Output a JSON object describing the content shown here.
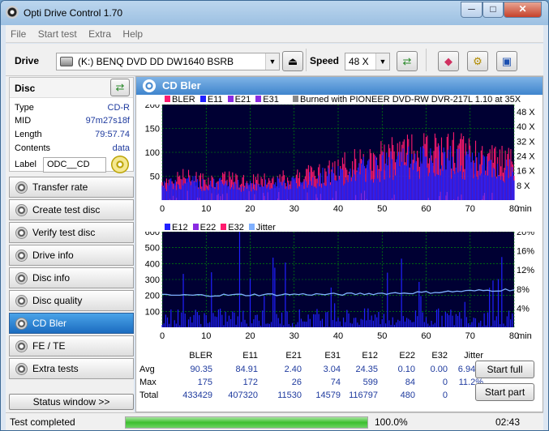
{
  "window": {
    "title": "Opti Drive Control 1.70",
    "min": "─",
    "max": "□",
    "close": "✕"
  },
  "menu": [
    "File",
    "Start test",
    "Extra",
    "Help"
  ],
  "toolbar": {
    "drive_label": "Drive",
    "drive_value": "(K:)  BENQ DVD DD DW1640 BSRB",
    "speed_label": "Speed",
    "speed_value": "48 X"
  },
  "disc": {
    "header": "Disc",
    "rows": [
      {
        "k": "Type",
        "v": "CD-R"
      },
      {
        "k": "MID",
        "v": "97m27s18f"
      },
      {
        "k": "Length",
        "v": "79:57.74"
      },
      {
        "k": "Contents",
        "v": "data"
      }
    ],
    "label_key": "Label",
    "label_value": "ODC__CD"
  },
  "nav": [
    "Transfer rate",
    "Create test disc",
    "Verify test disc",
    "Drive info",
    "Disc info",
    "Disc quality",
    "CD Bler",
    "FE / TE",
    "Extra tests"
  ],
  "nav_active": "CD Bler",
  "status_window_btn": "Status window >>",
  "main": {
    "title": "CD Bler",
    "legend1": [
      "BLER",
      "E11",
      "E21",
      "E31"
    ],
    "burned": "Burned with PIONEER DVD-RW  DVR-217L 1.10 at 35X",
    "legend2": [
      "E12",
      "E22",
      "E32",
      "Jitter"
    ],
    "colors": {
      "bler": "#ff1a6e",
      "e11": "#2020ff",
      "e21": "#8a2be2",
      "e31": "#8a2be2",
      "e12": "#2020ff",
      "e22": "#8a2be2",
      "e32": "#ff1a6e",
      "jitter": "#7fb0ff",
      "burned": "#888888",
      "bg": "#000033",
      "grid": "#00a000"
    }
  },
  "chart_data": [
    {
      "type": "bar",
      "title": "",
      "xlabel": "min",
      "x_ticks": [
        "0",
        "10",
        "20",
        "30",
        "40",
        "50",
        "60",
        "70",
        "80"
      ],
      "y_ticks": [
        "50",
        "100",
        "150",
        "200"
      ],
      "ylim": [
        0,
        200
      ],
      "xlim": [
        0,
        80
      ],
      "y2_ticks": [
        "8 X",
        "16 X",
        "24 X",
        "32 X",
        "40 X",
        "48 X"
      ],
      "y2_values": [
        8,
        16,
        24,
        32,
        40,
        48
      ],
      "series": [
        {
          "name": "BLER",
          "x": [
            0,
            5,
            10,
            15,
            20,
            25,
            30,
            35,
            40,
            45,
            50,
            55,
            60,
            65,
            70,
            75,
            80
          ],
          "values": [
            40,
            50,
            45,
            45,
            40,
            45,
            50,
            60,
            70,
            85,
            95,
            105,
            105,
            110,
            100,
            90,
            80
          ]
        },
        {
          "name": "E11",
          "x": [
            0,
            5,
            10,
            15,
            20,
            25,
            30,
            35,
            40,
            45,
            50,
            55,
            60,
            65,
            70,
            75,
            80
          ],
          "values": [
            35,
            45,
            40,
            40,
            35,
            40,
            45,
            55,
            60,
            75,
            85,
            95,
            95,
            100,
            90,
            80,
            70
          ]
        }
      ]
    },
    {
      "type": "bar",
      "title": "",
      "xlabel": "min",
      "x_ticks": [
        "0",
        "10",
        "20",
        "30",
        "40",
        "50",
        "60",
        "70",
        "80"
      ],
      "y_ticks": [
        "100",
        "200",
        "300",
        "400",
        "500",
        "600"
      ],
      "ylim": [
        0,
        600
      ],
      "xlim": [
        0,
        80
      ],
      "y2_ticks": [
        "4%",
        "8%",
        "12%",
        "16%",
        "20%"
      ],
      "y2_values": [
        4,
        8,
        12,
        16,
        20
      ],
      "series": [
        {
          "name": "Jitter",
          "x": [
            0,
            10,
            20,
            30,
            40,
            50,
            60,
            70,
            80
          ],
          "values": [
            6.7,
            6.7,
            6.8,
            6.9,
            6.9,
            7.1,
            7.3,
            7.6,
            7.9
          ]
        }
      ]
    }
  ],
  "stats": {
    "headers": [
      "BLER",
      "E11",
      "E21",
      "E31",
      "E12",
      "E22",
      "E32",
      "Jitter"
    ],
    "rows": [
      {
        "label": "Avg",
        "vals": [
          "90.35",
          "84.91",
          "2.40",
          "3.04",
          "24.35",
          "0.10",
          "0.00",
          "6.94%"
        ]
      },
      {
        "label": "Max",
        "vals": [
          "175",
          "172",
          "26",
          "74",
          "599",
          "84",
          "0",
          "11.2%"
        ]
      },
      {
        "label": "Total",
        "vals": [
          "433429",
          "407320",
          "11530",
          "14579",
          "116797",
          "480",
          "0",
          ""
        ]
      }
    ]
  },
  "buttons": {
    "start_full": "Start full",
    "start_part": "Start part"
  },
  "status": {
    "text": "Test completed",
    "progress_pct": 100,
    "progress_label": "100.0%",
    "time": "02:43"
  }
}
